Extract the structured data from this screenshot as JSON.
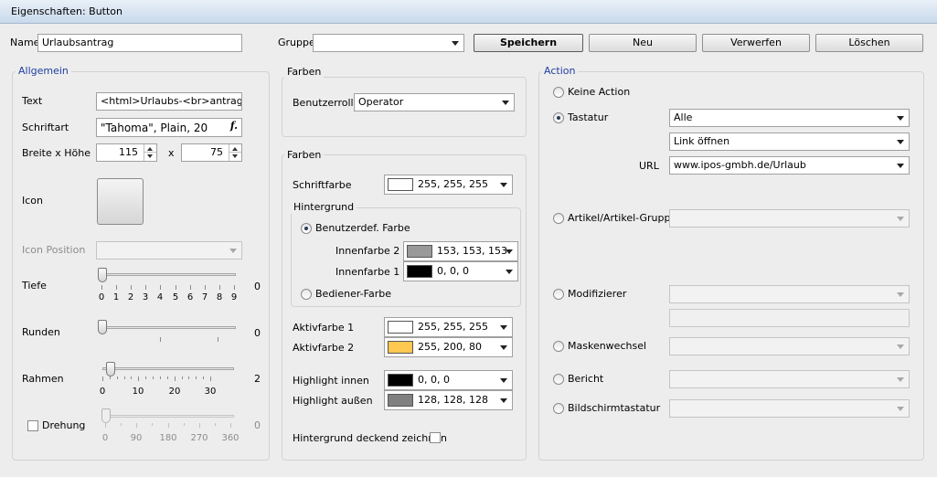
{
  "window": {
    "title": "Eigenschaften: Button"
  },
  "top": {
    "name_label": "Name",
    "name_value": "Urlaubsantrag",
    "gruppe_label": "Gruppe",
    "gruppe_value": "",
    "buttons": {
      "save": "Speichern",
      "new": "Neu",
      "discard": "Verwerfen",
      "delete": "Löschen"
    }
  },
  "allgemein": {
    "title": "Allgemein",
    "text_label": "Text",
    "text_value": "<html>Urlaubs-<br>antrag",
    "font_label": "Schriftart",
    "font_value": "\"Tahoma\", Plain, 20",
    "font_button_icon": "font-picker-icon",
    "size_label": "Breite x Höhe",
    "width_value": "115",
    "x_label": "x",
    "height_value": "75",
    "icon_label": "Icon",
    "icon_position_label": "Icon Position",
    "icon_position_value": "",
    "tiefe": {
      "label": "Tiefe",
      "value": "0",
      "ticks": [
        "0",
        "1",
        "2",
        "3",
        "4",
        "5",
        "6",
        "7",
        "8",
        "9"
      ]
    },
    "runden": {
      "label": "Runden",
      "value": "0"
    },
    "rahmen": {
      "label": "Rahmen",
      "value": "2",
      "ticks": [
        "0",
        "10",
        "20",
        "30"
      ]
    },
    "drehung": {
      "label": "Drehung",
      "checked": false,
      "value": "0",
      "ticks": [
        "0",
        "90",
        "180",
        "270",
        "360"
      ]
    }
  },
  "farben1": {
    "title": "Farben",
    "role_label": "Benutzerrolle",
    "role_value": "Operator"
  },
  "farben2": {
    "title": "Farben",
    "schriftfarbe": {
      "label": "Schriftfarbe",
      "value": "255, 255, 255",
      "color": "#ffffff"
    },
    "hintergrund": {
      "title": "Hintergrund",
      "custom_label": "Benutzerdef. Farbe",
      "inner2": {
        "label": "Innenfarbe 2",
        "value": "153, 153, 153",
        "color": "#999999"
      },
      "inner1": {
        "label": "Innenfarbe 1",
        "value": "0, 0, 0",
        "color": "#000000"
      },
      "operator_label": "Bediener-Farbe"
    },
    "aktiv1": {
      "label": "Aktivfarbe 1",
      "value": "255, 255, 255",
      "color": "#ffffff"
    },
    "aktiv2": {
      "label": "Aktivfarbe 2",
      "value": "255, 200, 80",
      "color": "#ffc850"
    },
    "hl_inner": {
      "label": "Highlight innen",
      "value": "0, 0, 0",
      "color": "#000000"
    },
    "hl_outer": {
      "label": "Highlight außen",
      "value": "128, 128, 128",
      "color": "#808080"
    },
    "opaque_label": "Hintergrund deckend zeichnen"
  },
  "action": {
    "title": "Action",
    "none_label": "Keine Action",
    "keyboard_label": "Tastatur",
    "keyboard_value": "Alle",
    "link_value": "Link öffnen",
    "url_label": "URL",
    "url_value": "www.ipos-gmbh.de/Urlaub",
    "article_label": "Artikel/Artikel-Gruppe",
    "modifier_label": "Modifizierer",
    "mask_label": "Maskenwechsel",
    "report_label": "Bericht",
    "screenkb_label": "Bildschirmtastatur"
  }
}
